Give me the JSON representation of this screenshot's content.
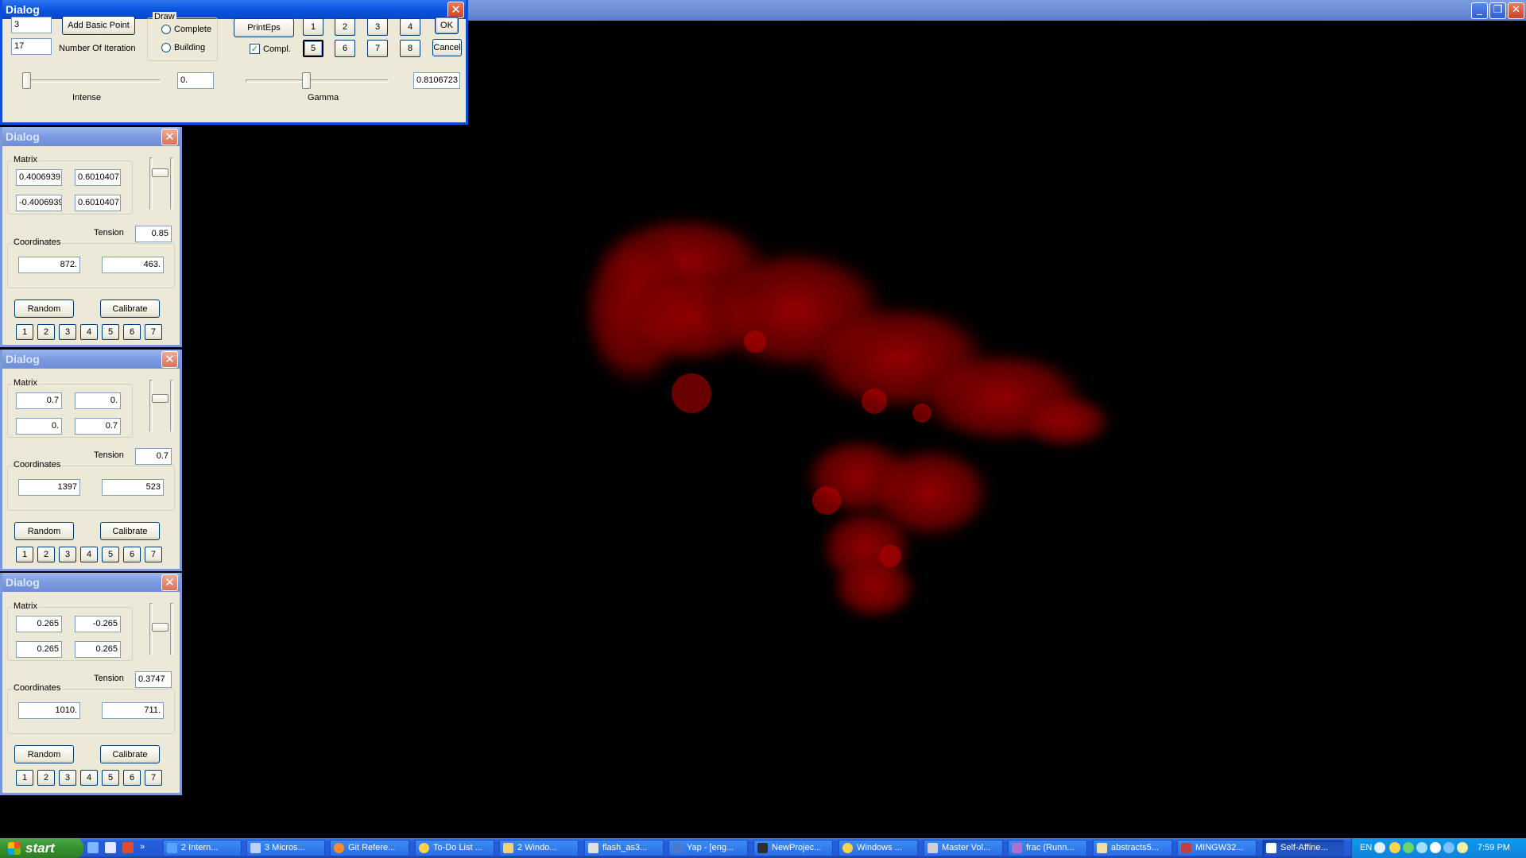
{
  "main_window": {
    "controls": [
      "minimize",
      "restore",
      "close"
    ]
  },
  "main_dialog": {
    "title": "Dialog",
    "basic_points_value": "3",
    "iterations_value": "17",
    "add_basic_point_label": "Add Basic Point",
    "number_of_iteration_label": "Number Of Iteration",
    "draw_group_label": "Draw",
    "radio_complete": "Complete",
    "radio_building": "Building",
    "print_eps_label": "PrintEps",
    "compl_label": "Compl.",
    "compl_checked": true,
    "number_buttons": [
      "1",
      "2",
      "3",
      "4",
      "5",
      "6",
      "7",
      "8"
    ],
    "ok_label": "OK",
    "cancel_label": "Cancel",
    "intense_value": "0.",
    "intense_label": "Intense",
    "gamma_value": "0.8106723",
    "gamma_label": "Gamma"
  },
  "point_dialogs": [
    {
      "title": "Dialog",
      "matrix_label": "Matrix",
      "m11": "0.4006939",
      "m12": "0.6010407",
      "m21": "-0.4006939",
      "m22": "0.6010407",
      "tension_label": "Tension",
      "tension": "0.85",
      "coords_label": "Coordinates",
      "x": "872.",
      "y": "463.",
      "random_label": "Random",
      "calibrate_label": "Calibrate",
      "buttons": [
        "1",
        "2",
        "3",
        "4",
        "5",
        "6",
        "7"
      ]
    },
    {
      "title": "Dialog",
      "matrix_label": "Matrix",
      "m11": "0.7",
      "m12": "0.",
      "m21": "0.",
      "m22": "0.7",
      "tension_label": "Tension",
      "tension": "0.7",
      "coords_label": "Coordinates",
      "x": "1397",
      "y": "523",
      "random_label": "Random",
      "calibrate_label": "Calibrate",
      "buttons": [
        "1",
        "2",
        "3",
        "4",
        "5",
        "6",
        "7"
      ]
    },
    {
      "title": "Dialog",
      "matrix_label": "Matrix",
      "m11": "0.265",
      "m12": "-0.265",
      "m21": "0.265",
      "m22": "0.265",
      "tension_label": "Tension",
      "tension": "0.3747",
      "coords_label": "Coordinates",
      "x": "1010.",
      "y": "711.",
      "random_label": "Random",
      "calibrate_label": "Calibrate",
      "buttons": [
        "1",
        "2",
        "3",
        "4",
        "5",
        "6",
        "7"
      ]
    }
  ],
  "fractal": {
    "color": "#b50000"
  },
  "taskbar": {
    "start_label": "start",
    "items": [
      "2 Intern...",
      "3 Micros...",
      "Git Refere...",
      "To-Do List ...",
      "2 Windo...",
      "flash_as3...",
      "Yap - [eng...",
      "NewProjec...",
      "Windows ...",
      "Master Vol...",
      "frac (Runn...",
      "abstracts5...",
      "MINGW32...",
      "Self-Affine..."
    ],
    "language": "EN",
    "clock": "7:59 PM"
  }
}
